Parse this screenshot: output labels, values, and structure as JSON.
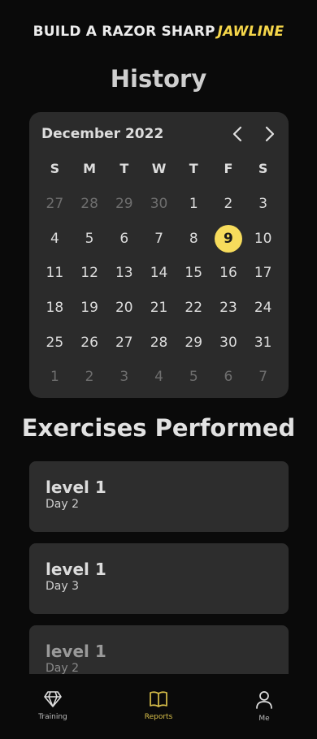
{
  "header": {
    "app_title_main": "BUILD A RAZOR SHARP",
    "app_title_accent": "JAWLINE",
    "page_title": "History"
  },
  "calendar": {
    "month_label": "December 2022",
    "weekdays": [
      "S",
      "M",
      "T",
      "W",
      "T",
      "F",
      "S"
    ],
    "weeks": [
      [
        {
          "d": "27",
          "m": true
        },
        {
          "d": "28",
          "m": true
        },
        {
          "d": "29",
          "m": true
        },
        {
          "d": "30",
          "m": true
        },
        {
          "d": "1"
        },
        {
          "d": "2"
        },
        {
          "d": "3"
        }
      ],
      [
        {
          "d": "4"
        },
        {
          "d": "5"
        },
        {
          "d": "6"
        },
        {
          "d": "7"
        },
        {
          "d": "8"
        },
        {
          "d": "9",
          "s": true
        },
        {
          "d": "10"
        }
      ],
      [
        {
          "d": "11"
        },
        {
          "d": "12"
        },
        {
          "d": "13"
        },
        {
          "d": "14"
        },
        {
          "d": "15"
        },
        {
          "d": "16"
        },
        {
          "d": "17"
        }
      ],
      [
        {
          "d": "18"
        },
        {
          "d": "19"
        },
        {
          "d": "20"
        },
        {
          "d": "21"
        },
        {
          "d": "22"
        },
        {
          "d": "23"
        },
        {
          "d": "24"
        }
      ],
      [
        {
          "d": "25"
        },
        {
          "d": "26"
        },
        {
          "d": "27"
        },
        {
          "d": "28"
        },
        {
          "d": "29"
        },
        {
          "d": "30"
        },
        {
          "d": "31"
        }
      ],
      [
        {
          "d": "1",
          "m": true
        },
        {
          "d": "2",
          "m": true
        },
        {
          "d": "3",
          "m": true
        },
        {
          "d": "4",
          "m": true
        },
        {
          "d": "5",
          "m": true
        },
        {
          "d": "6",
          "m": true
        },
        {
          "d": "7",
          "m": true
        }
      ]
    ],
    "selected_color": "#f7dc5c"
  },
  "exercises": {
    "title": "Exercises Performed",
    "items": [
      {
        "name": "level 1",
        "day": "Day 2"
      },
      {
        "name": "level 1",
        "day": "Day 3"
      },
      {
        "name": "level 1",
        "day": "Day 2"
      }
    ]
  },
  "tab_bar": {
    "tabs": [
      {
        "label": "Training",
        "icon": "diamond-icon"
      },
      {
        "label": "Reports",
        "icon": "book-icon",
        "active": true
      },
      {
        "label": "Me",
        "icon": "person-icon"
      }
    ]
  },
  "colors": {
    "accent": "#f5d64a",
    "background": "#0a0a0a",
    "card": "#2d2d2d"
  }
}
